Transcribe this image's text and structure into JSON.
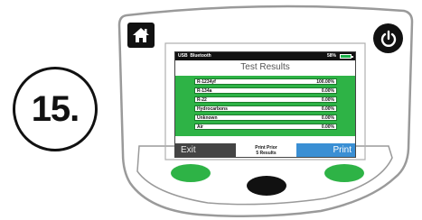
{
  "step": {
    "label": "15."
  },
  "device": {
    "home_icon": "home-icon",
    "power_icon": "power-icon",
    "colors": {
      "body": "#f5f5f5",
      "outline": "#9a9a9a",
      "green_button": "#2eb346",
      "center_button": "#111111"
    }
  },
  "screen": {
    "status": {
      "usb": "USB",
      "bluetooth": "Bluetooth",
      "battery_pct": "58%"
    },
    "title": "Test Results",
    "results": [
      {
        "name": "R-1234yf",
        "value": "100.00%"
      },
      {
        "name": "R-134a",
        "value": "0.00%"
      },
      {
        "name": "R-22",
        "value": "0.00%"
      },
      {
        "name": "Hydrocarbons",
        "value": "0.00%"
      },
      {
        "name": "Unknown",
        "value": "0.00%"
      },
      {
        "name": "Air",
        "value": "0.00%"
      }
    ],
    "buttons": {
      "exit": "Exit",
      "print_prior_line1": "Print Prior",
      "print_prior_line2": "5 Results",
      "print": "Print"
    },
    "colors": {
      "results_bg": "#2eb346",
      "exit_bg": "#444444",
      "print_bg": "#3a8fd4"
    }
  }
}
